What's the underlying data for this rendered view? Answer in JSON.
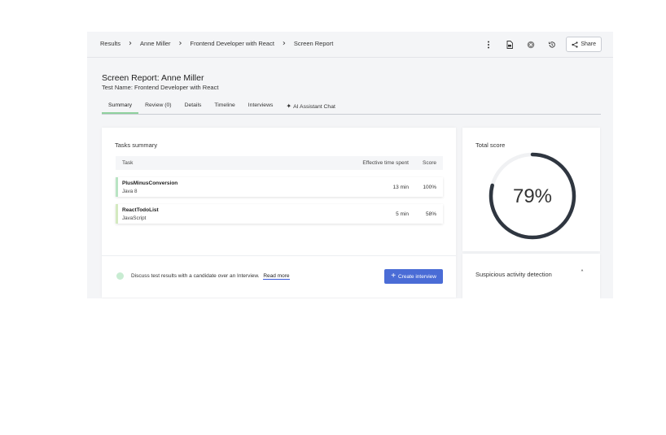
{
  "breadcrumbs": [
    "Results",
    "Anne Miller",
    "Frontend Developer with React",
    "Screen Report"
  ],
  "toolbar": {
    "share_label": "Share"
  },
  "report": {
    "title": "Screen Report: Anne Miller",
    "test_name": "Test Name: Frontend Developer with React"
  },
  "tabs": [
    "Summary",
    "Review (0)",
    "Details",
    "Timeline",
    "Interviews",
    "AI Assistant Chat"
  ],
  "active_tab": "Summary",
  "tasks_summary": {
    "heading": "Tasks summary",
    "columns": {
      "task": "Task",
      "time": "Effective time spent",
      "score": "Score"
    },
    "rows": [
      {
        "name": "PlusMinusConversion",
        "language": "Java 8",
        "time": "13 min",
        "score": "100%"
      },
      {
        "name": "ReactTodoList",
        "language": "JavaScript",
        "time": "5 min",
        "score": "58%"
      }
    ]
  },
  "interview_prompt": {
    "text": "Discuss test results with a candidate over an Interview.",
    "link": "Read more",
    "button": "Create interview"
  },
  "total_score": {
    "heading": "Total score",
    "value": 79,
    "label": "79%",
    "color": "#2f3640"
  },
  "suspicious": {
    "label": "Suspicious activity detection"
  },
  "colors": {
    "accent": "#4a6cd6",
    "tab_indicator": "#8fd19e"
  }
}
